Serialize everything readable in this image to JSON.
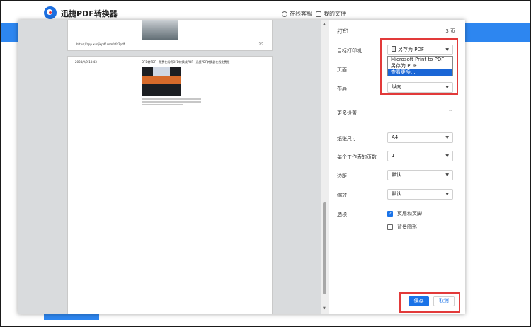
{
  "app": {
    "name": "迅捷PDF转换器",
    "online_service": "在线客服",
    "my_files": "我的文件"
  },
  "preview": {
    "page1": {
      "url": "https://app.xunjiepdf.com/ofd2pdf",
      "page_number": "2/3"
    },
    "page2": {
      "date": "2024/9/9 13:43",
      "title": "OFD转PDF - 免费在线将OFD转换成PDF - 迅捷PDF转换器在线免费版"
    }
  },
  "print": {
    "title": "打印",
    "page_count": "3 页",
    "destination_label": "目标打印机",
    "destination_value": "另存为 PDF",
    "destination_options": [
      "Microsoft Print to PDF",
      "另存为 PDF",
      "查看更多..."
    ],
    "destination_highlighted": "查看更多...",
    "pages_label": "页面",
    "layout_label": "布局",
    "layout_value": "纵向",
    "more_settings_label": "更多设置",
    "paper_size_label": "纸张尺寸",
    "paper_size_value": "A4",
    "pages_per_sheet_label": "每个工作表的页数",
    "pages_per_sheet_value": "1",
    "margins_label": "边距",
    "margins_value": "默认",
    "scale_label": "缩放",
    "scale_value": "默认",
    "options_label": "选项",
    "option_headers_footers": "页眉和页脚",
    "option_headers_footers_checked": true,
    "option_background": "背景图形",
    "option_background_checked": false,
    "save_button": "保存",
    "cancel_button": "取消"
  },
  "colors": {
    "accent": "#1a73e8",
    "app_blue": "#2d86f0",
    "highlight_red": "#e23a3a",
    "dropdown_selected": "#1a66d6"
  }
}
